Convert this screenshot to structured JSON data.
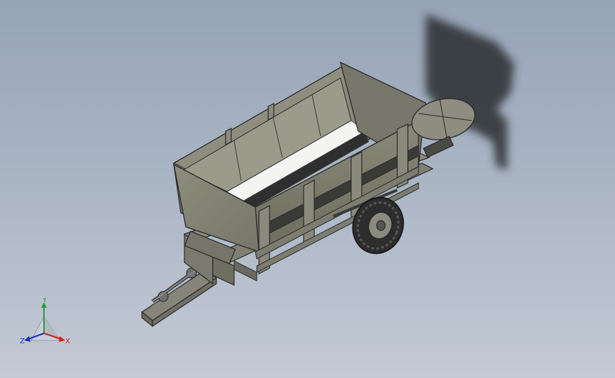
{
  "view": {
    "background_top": "#97a4b6",
    "background_bottom": "#c3cad5",
    "model": "trailer-spreader-assembly"
  },
  "triad": {
    "x_label": "X",
    "y_label": "Y",
    "z_label": "Z",
    "x_color": "#d22020",
    "y_color": "#20a040",
    "z_color": "#2030c0"
  }
}
